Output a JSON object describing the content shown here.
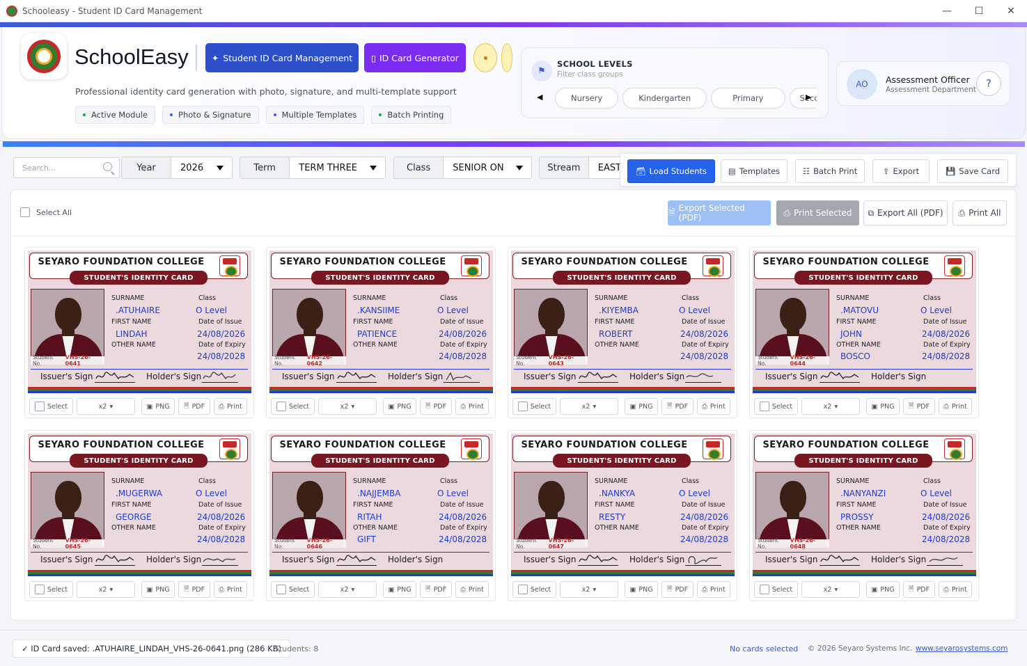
{
  "window": {
    "title": "Schooleasy - Student ID Card Management"
  },
  "header": {
    "brand": "SchoolEasy",
    "subtitle": "Professional identity card generation with photo, signature, and multi-template support",
    "primary_button": "Student ID Card Management",
    "generator_button": "ID Card Generator",
    "chips": [
      "Active Module",
      "Photo & Signature",
      "Multiple Templates",
      "Batch Printing"
    ],
    "chip_colors": [
      "#16a34a",
      "#2563eb",
      "#7c3aed",
      "#16a34a"
    ]
  },
  "levels": {
    "title": "SCHOOL LEVELS",
    "subtitle": "Filter class groups",
    "tabs": [
      "Nursery",
      "Kindergarten",
      "Primary",
      "Seco"
    ]
  },
  "officer": {
    "initials": "AO",
    "name": "Assessment Officer",
    "department": "Assessment Department",
    "help": "?"
  },
  "filters": {
    "search_placeholder": "Search...",
    "year_label": "Year",
    "year_value": "2026",
    "term_label": "Term",
    "term_value": "TERM THREE",
    "class_label": "Class",
    "class_value": "SENIOR ON",
    "stream_label": "Stream",
    "stream_value": "EAST"
  },
  "actions": {
    "load": "Load Students",
    "templates": "Templates",
    "batch": "Batch Print",
    "export": "Export",
    "save": "Save Card"
  },
  "selection": {
    "select_all": "Select All",
    "export_selected": "Export Selected (PDF)",
    "print_selected": "Print Selected",
    "export_all": "Export All (PDF)",
    "print_all": "Print All"
  },
  "card_template": {
    "school": "SEYARO FOUNDATION COLLEGE",
    "banner": "STUDENT'S IDENTITY CARD",
    "surname_label": "SURNAME",
    "first_label": "FIRST NAME",
    "other_label": "OTHER NAME",
    "class_label": "Class",
    "issue_label": "Date of Issue",
    "expiry_label": "Date of Expiry",
    "student_no_label": "Student No.",
    "issuer_sign": "Issuer's Sign",
    "holder_sign": "Holder's Sign"
  },
  "card_controls": {
    "select": "Select",
    "copies": "x2",
    "png": "PNG",
    "pdf": "PDF",
    "print": "Print"
  },
  "students": [
    {
      "surname": ".ATUHAIRE",
      "first": "LINDAH",
      "other": "",
      "class": "O Level",
      "issue": "24/08/2026",
      "expiry": "24/08/2028",
      "number": "VHS-26-0641"
    },
    {
      "surname": ".KANSIIME",
      "first": "PATIENCE",
      "other": "",
      "class": "O Level",
      "issue": "24/08/2026",
      "expiry": "24/08/2028",
      "number": "VHS-26-0642"
    },
    {
      "surname": ".KIYEMBA",
      "first": "ROBERT",
      "other": "",
      "class": "O Level",
      "issue": "24/08/2026",
      "expiry": "24/08/2028",
      "number": "VHS-26-0643"
    },
    {
      "surname": ".MATOVU",
      "first": "JOHN",
      "other": "BOSCO",
      "class": "O Level",
      "issue": "24/08/2026",
      "expiry": "24/08/2028",
      "number": "VHS-26-0644"
    },
    {
      "surname": ".MUGERWA",
      "first": "GEORGE",
      "other": "",
      "class": "O Level",
      "issue": "24/08/2026",
      "expiry": "24/08/2028",
      "number": "VHS-26-0645"
    },
    {
      "surname": ".NAJJEMBA",
      "first": "RITAH",
      "other": "GIFT",
      "class": "O Level",
      "issue": "24/08/2026",
      "expiry": "24/08/2028",
      "number": "VHS-26-0646"
    },
    {
      "surname": ".NANKYA",
      "first": "RESTY",
      "other": "",
      "class": "O Level",
      "issue": "24/08/2026",
      "expiry": "24/08/2028",
      "number": "VHS-26-0647"
    },
    {
      "surname": ".NANYANZI",
      "first": "PROSSY",
      "other": "",
      "class": "O Level",
      "issue": "24/08/2026",
      "expiry": "24/08/2028",
      "number": "VHS-26-0648"
    }
  ],
  "status": {
    "message": "✓ ID Card saved: .ATUHAIRE_LINDAH_VHS-26-0641.png (286 KB)",
    "count": "Students: 8",
    "selection": "No cards selected",
    "copyright": "© 2026 Seyaro Systems Inc.",
    "link": "www.seyarosystems.com"
  },
  "colors": {
    "primary": "#2c4ec8",
    "accent": "#7b2cf0",
    "card_maroon": "#781621",
    "value_blue": "#1e3cd1"
  }
}
